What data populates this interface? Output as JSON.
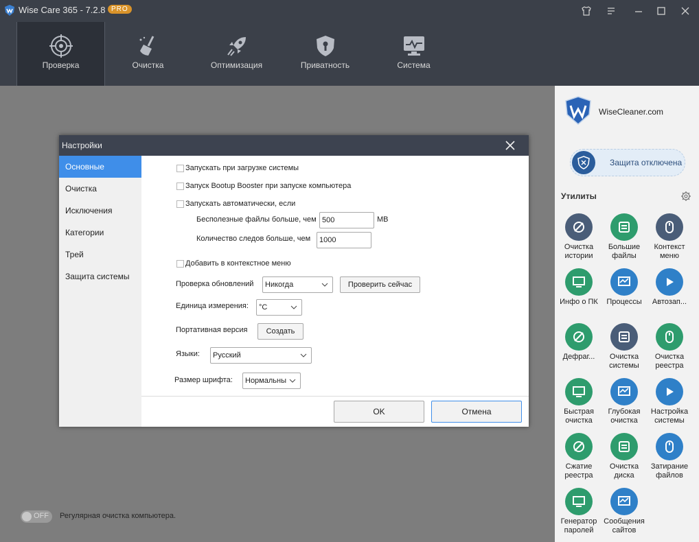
{
  "app": {
    "title": "Wise Care 365 - 7.2.8",
    "badge": "PRO"
  },
  "nav": [
    {
      "label": "Проверка",
      "icon": "target-icon"
    },
    {
      "label": "Очистка",
      "icon": "broom-icon"
    },
    {
      "label": "Оптимизация",
      "icon": "rocket-icon"
    },
    {
      "label": "Приватность",
      "icon": "shield-icon"
    },
    {
      "label": "Система",
      "icon": "monitor-icon"
    }
  ],
  "sidebar": {
    "brand": "WiseCleaner.com",
    "protection": "Защита отключена",
    "utilities_title": "Утилиты",
    "tools": [
      {
        "label": "Очистка истории",
        "color": "#4a5d78"
      },
      {
        "label": "Большие файлы",
        "color": "#2e9c6d"
      },
      {
        "label": "Контекст меню",
        "color": "#4a5d78"
      },
      {
        "label": "Инфо о ПК",
        "color": "#2e9c6d"
      },
      {
        "label": "Процессы",
        "color": "#2f80c8"
      },
      {
        "label": "Автозап...",
        "color": "#2f80c8"
      },
      {
        "label": "Дефраг...",
        "color": "#2e9c6d"
      },
      {
        "label": "Очистка системы",
        "color": "#4a5d78"
      },
      {
        "label": "Очистка реестра",
        "color": "#2e9c6d"
      },
      {
        "label": "Быстрая очистка",
        "color": "#2e9c6d"
      },
      {
        "label": "Глубокая очистка",
        "color": "#2f80c8"
      },
      {
        "label": "Настройка системы",
        "color": "#2f80c8"
      },
      {
        "label": "Сжатие реестра",
        "color": "#2e9c6d"
      },
      {
        "label": "Очистка диска",
        "color": "#2e9c6d"
      },
      {
        "label": "Затирание файлов",
        "color": "#2f80c8"
      },
      {
        "label": "Генератор паролей",
        "color": "#2e9c6d"
      },
      {
        "label": "Сообщения сайтов",
        "color": "#2f80c8"
      }
    ]
  },
  "bottom": {
    "toggle": "OFF",
    "text": "Регулярная очистка компьютера."
  },
  "dialog": {
    "title": "Настройки",
    "tabs": [
      "Основные",
      "Очистка",
      "Исключения",
      "Категории",
      "Трей",
      "Защита системы"
    ],
    "general": {
      "startup": "Запускать при загрузке системы",
      "bootup_booster": "Запуск Bootup Booster при запуске компьютера",
      "auto_run": "Запускать автоматически, если",
      "junk_label": "Бесполезные файлы больше, чем",
      "junk_value": "500",
      "junk_unit": "MB",
      "traces_label": "Количество следов больше, чем",
      "traces_value": "1000",
      "context_menu": "Добавить в контекстное меню",
      "updates_label": "Проверка обновлений",
      "updates_value": "Никогда",
      "check_now": "Проверить сейчас",
      "units_label": "Единица измерения:",
      "units_value": "°C",
      "portable_label": "Портативная версия",
      "create": "Создать",
      "lang_label": "Языки:",
      "lang_value": "Русский",
      "font_label": "Размер шрифта:",
      "font_value": "Нормальны"
    },
    "ok": "OK",
    "cancel": "Отмена"
  }
}
